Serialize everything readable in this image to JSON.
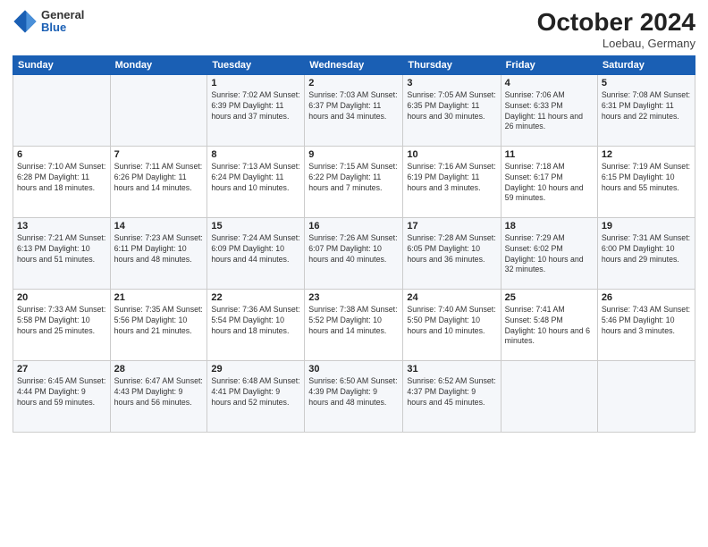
{
  "header": {
    "logo_general": "General",
    "logo_blue": "Blue",
    "month_title": "October 2024",
    "location": "Loebau, Germany"
  },
  "days_of_week": [
    "Sunday",
    "Monday",
    "Tuesday",
    "Wednesday",
    "Thursday",
    "Friday",
    "Saturday"
  ],
  "weeks": [
    [
      {
        "day": "",
        "info": ""
      },
      {
        "day": "",
        "info": ""
      },
      {
        "day": "1",
        "info": "Sunrise: 7:02 AM\nSunset: 6:39 PM\nDaylight: 11 hours\nand 37 minutes."
      },
      {
        "day": "2",
        "info": "Sunrise: 7:03 AM\nSunset: 6:37 PM\nDaylight: 11 hours\nand 34 minutes."
      },
      {
        "day": "3",
        "info": "Sunrise: 7:05 AM\nSunset: 6:35 PM\nDaylight: 11 hours\nand 30 minutes."
      },
      {
        "day": "4",
        "info": "Sunrise: 7:06 AM\nSunset: 6:33 PM\nDaylight: 11 hours\nand 26 minutes."
      },
      {
        "day": "5",
        "info": "Sunrise: 7:08 AM\nSunset: 6:31 PM\nDaylight: 11 hours\nand 22 minutes."
      }
    ],
    [
      {
        "day": "6",
        "info": "Sunrise: 7:10 AM\nSunset: 6:28 PM\nDaylight: 11 hours\nand 18 minutes."
      },
      {
        "day": "7",
        "info": "Sunrise: 7:11 AM\nSunset: 6:26 PM\nDaylight: 11 hours\nand 14 minutes."
      },
      {
        "day": "8",
        "info": "Sunrise: 7:13 AM\nSunset: 6:24 PM\nDaylight: 11 hours\nand 10 minutes."
      },
      {
        "day": "9",
        "info": "Sunrise: 7:15 AM\nSunset: 6:22 PM\nDaylight: 11 hours\nand 7 minutes."
      },
      {
        "day": "10",
        "info": "Sunrise: 7:16 AM\nSunset: 6:19 PM\nDaylight: 11 hours\nand 3 minutes."
      },
      {
        "day": "11",
        "info": "Sunrise: 7:18 AM\nSunset: 6:17 PM\nDaylight: 10 hours\nand 59 minutes."
      },
      {
        "day": "12",
        "info": "Sunrise: 7:19 AM\nSunset: 6:15 PM\nDaylight: 10 hours\nand 55 minutes."
      }
    ],
    [
      {
        "day": "13",
        "info": "Sunrise: 7:21 AM\nSunset: 6:13 PM\nDaylight: 10 hours\nand 51 minutes."
      },
      {
        "day": "14",
        "info": "Sunrise: 7:23 AM\nSunset: 6:11 PM\nDaylight: 10 hours\nand 48 minutes."
      },
      {
        "day": "15",
        "info": "Sunrise: 7:24 AM\nSunset: 6:09 PM\nDaylight: 10 hours\nand 44 minutes."
      },
      {
        "day": "16",
        "info": "Sunrise: 7:26 AM\nSunset: 6:07 PM\nDaylight: 10 hours\nand 40 minutes."
      },
      {
        "day": "17",
        "info": "Sunrise: 7:28 AM\nSunset: 6:05 PM\nDaylight: 10 hours\nand 36 minutes."
      },
      {
        "day": "18",
        "info": "Sunrise: 7:29 AM\nSunset: 6:02 PM\nDaylight: 10 hours\nand 32 minutes."
      },
      {
        "day": "19",
        "info": "Sunrise: 7:31 AM\nSunset: 6:00 PM\nDaylight: 10 hours\nand 29 minutes."
      }
    ],
    [
      {
        "day": "20",
        "info": "Sunrise: 7:33 AM\nSunset: 5:58 PM\nDaylight: 10 hours\nand 25 minutes."
      },
      {
        "day": "21",
        "info": "Sunrise: 7:35 AM\nSunset: 5:56 PM\nDaylight: 10 hours\nand 21 minutes."
      },
      {
        "day": "22",
        "info": "Sunrise: 7:36 AM\nSunset: 5:54 PM\nDaylight: 10 hours\nand 18 minutes."
      },
      {
        "day": "23",
        "info": "Sunrise: 7:38 AM\nSunset: 5:52 PM\nDaylight: 10 hours\nand 14 minutes."
      },
      {
        "day": "24",
        "info": "Sunrise: 7:40 AM\nSunset: 5:50 PM\nDaylight: 10 hours\nand 10 minutes."
      },
      {
        "day": "25",
        "info": "Sunrise: 7:41 AM\nSunset: 5:48 PM\nDaylight: 10 hours\nand 6 minutes."
      },
      {
        "day": "26",
        "info": "Sunrise: 7:43 AM\nSunset: 5:46 PM\nDaylight: 10 hours\nand 3 minutes."
      }
    ],
    [
      {
        "day": "27",
        "info": "Sunrise: 6:45 AM\nSunset: 4:44 PM\nDaylight: 9 hours\nand 59 minutes."
      },
      {
        "day": "28",
        "info": "Sunrise: 6:47 AM\nSunset: 4:43 PM\nDaylight: 9 hours\nand 56 minutes."
      },
      {
        "day": "29",
        "info": "Sunrise: 6:48 AM\nSunset: 4:41 PM\nDaylight: 9 hours\nand 52 minutes."
      },
      {
        "day": "30",
        "info": "Sunrise: 6:50 AM\nSunset: 4:39 PM\nDaylight: 9 hours\nand 48 minutes."
      },
      {
        "day": "31",
        "info": "Sunrise: 6:52 AM\nSunset: 4:37 PM\nDaylight: 9 hours\nand 45 minutes."
      },
      {
        "day": "",
        "info": ""
      },
      {
        "day": "",
        "info": ""
      }
    ]
  ]
}
